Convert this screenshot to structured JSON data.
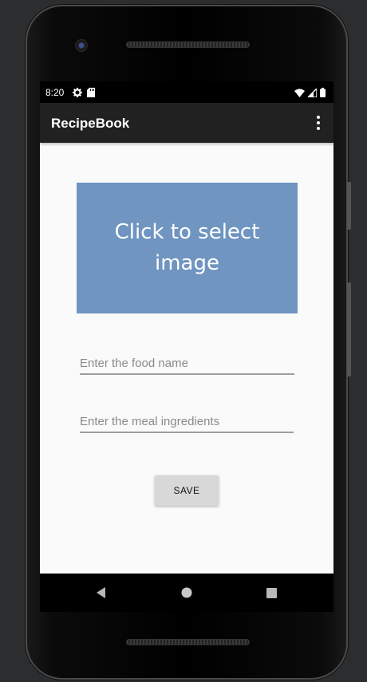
{
  "status_bar": {
    "time": "8:20",
    "icons": [
      "gear-icon",
      "sd-card-icon",
      "wifi-icon",
      "signal-icon",
      "battery-icon"
    ]
  },
  "app_bar": {
    "title": "RecipeBook",
    "menu_icon": "overflow-menu-icon"
  },
  "main": {
    "image_picker_label": "Click to select image",
    "image_picker_color": "#6f95c0",
    "food_name_placeholder": "Enter the food name",
    "food_name_value": "",
    "ingredients_placeholder": "Enter the meal ingredients",
    "ingredients_value": "",
    "save_label": "SAVE"
  },
  "nav_bar": {
    "buttons": [
      "back-icon",
      "home-icon",
      "recents-icon"
    ]
  }
}
